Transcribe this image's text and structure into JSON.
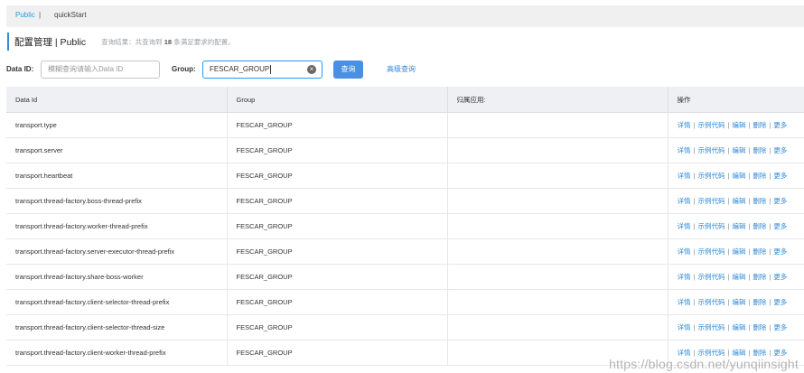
{
  "namespace_bar": {
    "current": "Public",
    "separator": "|",
    "other": "quickStart"
  },
  "heading": {
    "title": "配置管理 | Public",
    "summary_prefix": "查询结果：共查询到",
    "summary_count": "18",
    "summary_suffix": "条满足要求的配置。"
  },
  "search": {
    "dataid_label": "Data ID:",
    "dataid_placeholder": "模糊查询请输入Data ID",
    "group_label": "Group:",
    "group_value": "FESCAR_GROUP",
    "query_label": "查询",
    "advanced_label": "高级查询"
  },
  "table": {
    "columns": [
      "Data Id",
      "Group",
      "归属应用:",
      "操作"
    ],
    "op_labels": [
      "详情",
      "示例代码",
      "编辑",
      "删除",
      "更多"
    ],
    "rows": [
      {
        "data_id": "transport.type",
        "group": "FESCAR_GROUP",
        "app": ""
      },
      {
        "data_id": "transport.server",
        "group": "FESCAR_GROUP",
        "app": ""
      },
      {
        "data_id": "transport.heartbeat",
        "group": "FESCAR_GROUP",
        "app": ""
      },
      {
        "data_id": "transport.thread-factory.boss-thread-prefix",
        "group": "FESCAR_GROUP",
        "app": ""
      },
      {
        "data_id": "transport.thread-factory.worker-thread-prefix",
        "group": "FESCAR_GROUP",
        "app": ""
      },
      {
        "data_id": "transport.thread-factory.server-executor-thread-prefix",
        "group": "FESCAR_GROUP",
        "app": ""
      },
      {
        "data_id": "transport.thread-factory.share-boss-worker",
        "group": "FESCAR_GROUP",
        "app": ""
      },
      {
        "data_id": "transport.thread-factory.client-selector-thread-prefix",
        "group": "FESCAR_GROUP",
        "app": ""
      },
      {
        "data_id": "transport.thread-factory.client-selector-thread-size",
        "group": "FESCAR_GROUP",
        "app": ""
      },
      {
        "data_id": "transport.thread-factory.client-worker-thread-prefix",
        "group": "FESCAR_GROUP",
        "app": ""
      }
    ]
  },
  "watermark": "https://blog.csdn.net/yunqiinsight",
  "colors": {
    "accent": "#2f8ad8",
    "button": "#4a90e2",
    "header_bg": "#eef0f3",
    "namespace_active": "#1da1e2"
  }
}
